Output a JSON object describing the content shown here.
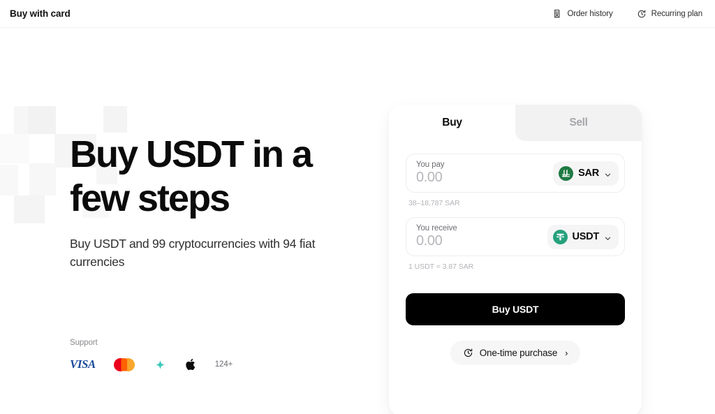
{
  "topbar": {
    "title": "Buy with card",
    "actions": [
      {
        "label": "Order history",
        "icon": "receipt-icon"
      },
      {
        "label": "Recurring plan",
        "icon": "clock-rotate-icon"
      }
    ]
  },
  "hero": {
    "title_line1": "Buy USDT in a",
    "title_line2": "few steps",
    "subtitle": "Buy USDT and 99 cryptocurrencies with 94 fiat currencies"
  },
  "support": {
    "label": "Support",
    "methods": [
      {
        "name": "visa-logo",
        "text": "VISA"
      },
      {
        "name": "mastercard-logo",
        "text": ""
      },
      {
        "name": "payment-provider-logo",
        "text": ""
      },
      {
        "name": "apple-pay-logo",
        "text": ""
      }
    ],
    "more_count": "124+"
  },
  "widget": {
    "tabs": [
      {
        "label": "Buy",
        "active": true
      },
      {
        "label": "Sell",
        "active": false
      }
    ],
    "pay": {
      "label": "You pay",
      "value": "0.00",
      "placeholder": "0.00",
      "currency_code": "SAR",
      "currency_icon": "sar-coin-icon",
      "limits_hint": "38–18,787 SAR"
    },
    "receive": {
      "label": "You receive",
      "value": "0.00",
      "placeholder": "0.00",
      "currency_code": "USDT",
      "currency_icon": "usdt-coin-icon",
      "rate_hint": "1 USDT = 3.87 SAR"
    },
    "cta_label": "Buy USDT",
    "purchase_mode": {
      "label": "One-time purchase",
      "icon": "clock-rotate-icon",
      "arrow": "›"
    }
  },
  "colors": {
    "cta_background": "#000000",
    "sar_green": "#1f7a43",
    "usdt_green": "#26a17b",
    "visa_blue": "#1a4b9c",
    "mastercard_red": "#eb001b",
    "mastercard_orange": "#f79e1b",
    "provider_teal": "#3fc8bd",
    "inactive_tab_bg": "#f2f2f3"
  }
}
